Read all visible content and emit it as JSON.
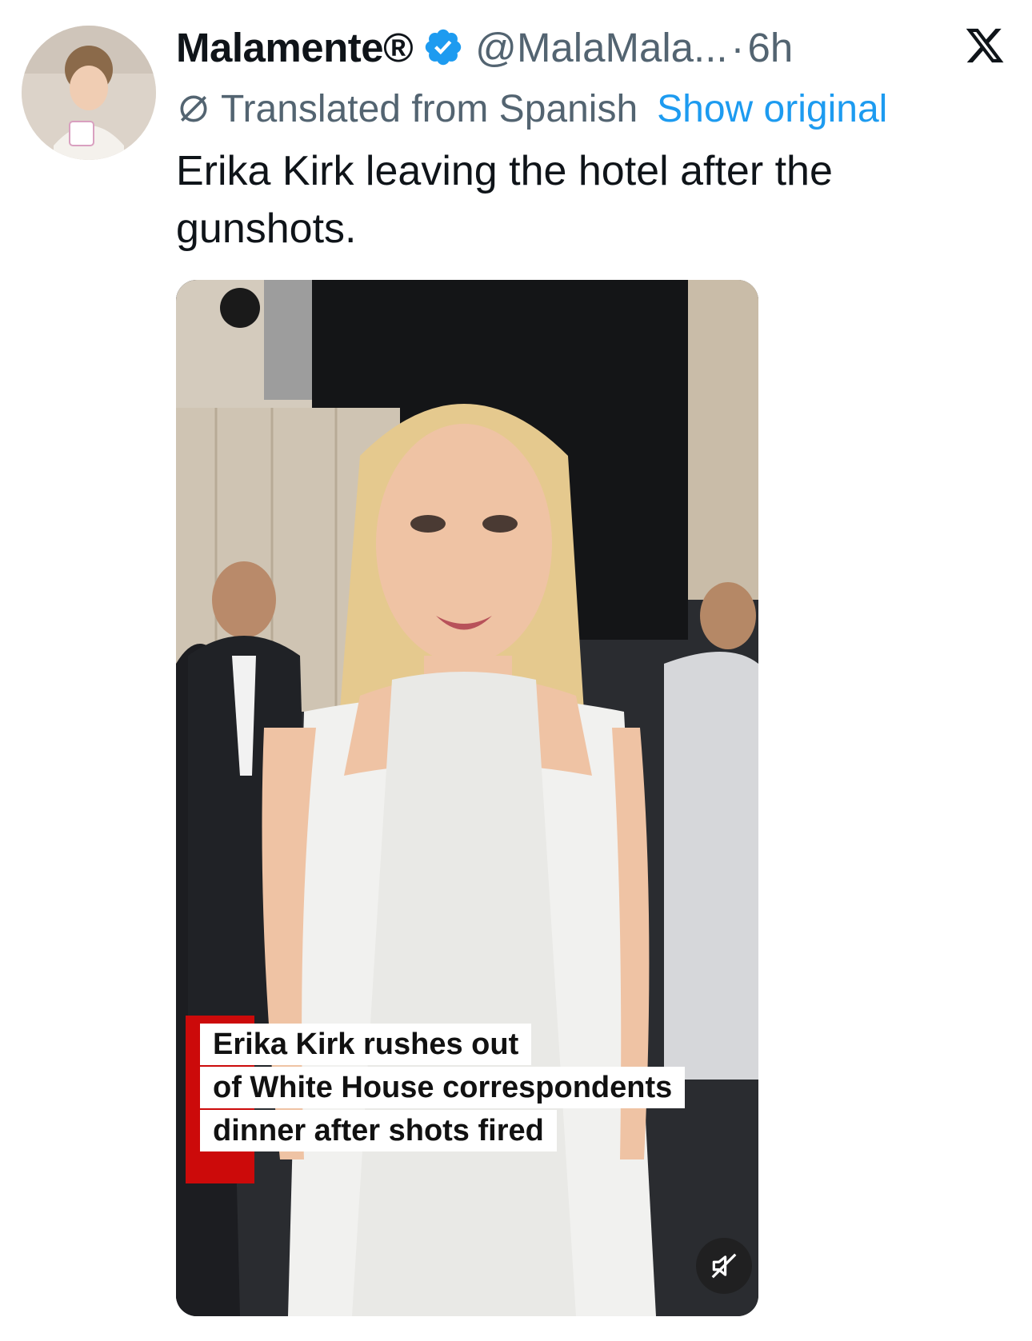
{
  "tweet": {
    "display_name": "Malamente®",
    "handle": "@MalaMala...",
    "separator": "·",
    "time": "6h",
    "translation": {
      "label": "Translated from Spanish",
      "show_original": "Show original"
    },
    "text": "Erika Kirk leaving the hotel after the gunshots."
  },
  "media": {
    "caption_lines": [
      "Erika Kirk rushes out",
      "of White House correspondents",
      "dinner after shots fired"
    ]
  },
  "icons": {
    "verified": "verified-badge-icon",
    "brand": "x-logo-icon",
    "translate": "translate-icon",
    "mute": "muted-speaker-icon"
  },
  "colors": {
    "link": "#1d9bf0",
    "verified": "#1d9bf0",
    "secondary_text": "#536471",
    "caption_accent": "#cc0a0a"
  }
}
